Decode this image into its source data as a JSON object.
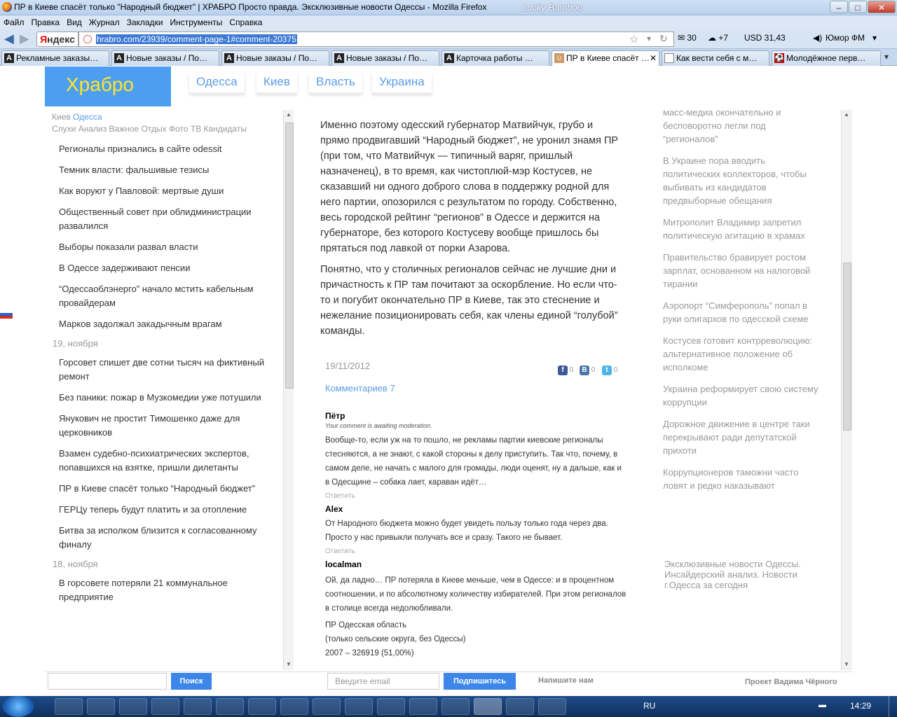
{
  "window": {
    "title": "ПР в Киеве спасёт только \"Народный бюджет\" | ХРАБРО Просто правда. Эксклюзивные новости Одессы - Mozilla Firefox",
    "theme_label": "Lucky Bamboo",
    "min": "–",
    "max": "□",
    "close": "✕"
  },
  "menu": [
    "Файл",
    "Правка",
    "Вид",
    "Журнал",
    "Закладки",
    "Инструменты",
    "Справка"
  ],
  "toolbar": {
    "yandex_y": "Я",
    "yandex_rest": "ндекс",
    "url": "hrabro.com/23939/comment-page-1#comment-20375",
    "mail": "✉ 30",
    "weather": "☁ +7",
    "currency": "USD 31,43",
    "radio": "Юмор ФМ"
  },
  "tabs": [
    {
      "label": "Рекламные заказы…",
      "icon": "A"
    },
    {
      "label": "Новые заказы / По…",
      "icon": "A"
    },
    {
      "label": "Новые заказы / По…",
      "icon": "A"
    },
    {
      "label": "Новые заказы / По…",
      "icon": "A"
    },
    {
      "label": "Карточка работы …",
      "icon": "A"
    },
    {
      "label": "ПР в Киеве спасёт …",
      "icon": "☺"
    },
    {
      "label": "Как вести себя с м…",
      "icon": ""
    },
    {
      "label": "Молодёжное перв…",
      "icon": "⚽"
    }
  ],
  "site": {
    "logo": "Храбро",
    "nav": [
      "Одесса",
      "Киев",
      "Власть",
      "Украина"
    ]
  },
  "sidebar": {
    "head1a": "Киев",
    "head1b": "Одесса",
    "head2": "Слухи Анализ Важное Отдых Фото ТВ Кандидаты",
    "group1": [
      "Регионалы признались в сайте odessit",
      "Темник власти: фальшивые тезисы",
      "Как воруют у Павловой: мертвые души",
      "Общественный совет при облидминистрации развалился",
      "Выборы показали развал власти",
      "В Одессе задерживают пенсии",
      "“Одессаоблэнерго” начало мстить кабельным провайдерам",
      "Марков задолжал закадычным врагам"
    ],
    "date1": "19, ноября",
    "group2": [
      "Горсовет спишет две сотни тысяч на фиктивный ремонт",
      "Без паники: пожар в Музкомедии уже потушили",
      "Янукович не простит Тимошенко даже для церковников",
      "Взамен судебно-психиатрических экспертов, попавшихся на взятке, пришли дилетанты",
      "ПР в Киеве спасёт только “Народный бюджет”",
      "ГЕРЦу теперь будут платить и за отопление",
      "Битва за исполком близится к согласованному финалу"
    ],
    "date2": "18, ноября",
    "group3": [
      "В горсовете потеряли 21 коммунальное предприятие"
    ]
  },
  "article": {
    "p1": "Именно поэтому одесский губернатор Матвийчук, грубо и прямо продвигавший “Народный бюджет”, не уронил знамя ПР (при том, что Матвийчук — типичный варяг, пришлый назначенец), в то время, как чистоплюй-мэр Костусев, не сказавший ни одного доброго слова в поддержку родной для него партии, опозорился с результатом по городу. Собственно, весь городской рейтинг “регионов” в Одессе и держится на губернаторе, без которого Костусеву вообще пришлось бы прятаться под лавкой от порки Азарова.",
    "p2": "Понятно, что у столичных регионалов сейчас не лучшие дни и причастность к ПР там почитают за оскорбление. Но если что-то и погубит окончательно ПР в Киеве, так это стеснение и нежелание позиционировать себя, как члены единой “голубой” команды.",
    "date": "19/11/2012",
    "share": {
      "fb": "f",
      "vk": "B",
      "tw": "t",
      "count": "0"
    },
    "comments_count": "Комментариев 7"
  },
  "comments": [
    {
      "author": "Пётр",
      "mod": "Your comment is awaiting moderation.",
      "text": "Вообще-то, если уж на то пошло, не рекламы партии киевские регионалы стесняются, а не знают, с какой стороны к делу приступить. Так что, почему, в самом деле, не начать с малого для громады, люди оценят, ну а дальше, как и в Одесщине – собака лает, караван идёт…",
      "reply": "Ответить"
    },
    {
      "author": "Alex",
      "mod": "",
      "text": "От Народного бюджета можно будет увидеть пользу только года через два. Просто у нас привыкли получать все и сразу. Такого не бывает.",
      "reply": "Ответить"
    },
    {
      "author": "localman",
      "mod": "",
      "text": "Ой, да ладно… ПР потеряла в Киеве меньше, чем в Одессе: и в процентном соотношении, и по абсолютному количеству избирателей. При этом регионалов в столице всегда недолюбливали.",
      "reply": ""
    }
  ],
  "comment_extra": [
    "ПР Одесская область",
    "(только сельские округа, без Одессы)",
    "2007 – 326919 (51,00%)"
  ],
  "rightcol": [
    "масс-медиа окончательно и бесповоротно легли под “регионалов”",
    "В Украине пора вводить политических коллекторов, чтобы выбивать из кандидатов предвыборные обещания",
    "Митрополит Владимир запретил политическую агитацию в храмах",
    "Правительство бравирует ростом зарплат, основанном на налоговой тирании",
    "Аэропорт “Симферополь” попал в руки олигархов по одесской схеме",
    "Костусев готовит контрреволюцию: альтернативное положение об исполкоме",
    "Украина реформирует свою систему коррупции",
    "Дорожное движение в центре таки перекрывают ради депутатской прихоти",
    "Коррупционеров таможни часто ловят и редко наказывают"
  ],
  "rightfoot": "Эксклюзивные новости Одессы. Инсайдерский анализ. Новости г.Одесса за сегодня",
  "footer": {
    "search_btn": "Поиск",
    "email_placeholder": "Введите email",
    "subscribe_btn": "Подпишитесь",
    "write_us": "Напишите нам",
    "project": "Проект Вадима Чёрного"
  },
  "taskbar": {
    "lang": "RU",
    "time": "14:29"
  }
}
